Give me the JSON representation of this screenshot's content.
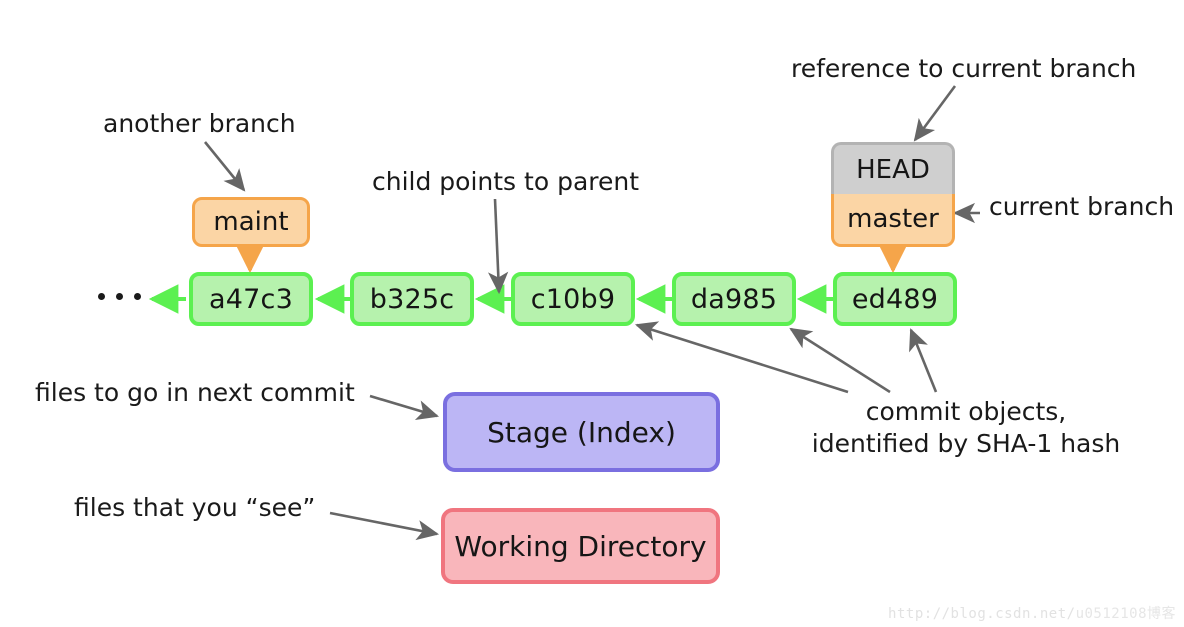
{
  "colors": {
    "commit_fill": "#b6f2ad",
    "commit_border": "#5cf051",
    "branch_fill": "#fbd5a5",
    "branch_border": "#f5a54a",
    "head_fill": "#cfcfcf",
    "head_border": "#b3b3b3",
    "stage_fill": "#bcb6f5",
    "stage_border": "#7a6fe0",
    "workdir_fill": "#f9b6bb",
    "workdir_border": "#f0757f",
    "annotation_arrow": "#666666",
    "text": "#1a1a1a"
  },
  "commits": [
    {
      "id": "a47c3",
      "label": "a47c3"
    },
    {
      "id": "b325c",
      "label": "b325c"
    },
    {
      "id": "c10b9",
      "label": "c10b9"
    },
    {
      "id": "da985",
      "label": "da985"
    },
    {
      "id": "ed489",
      "label": "ed489"
    }
  ],
  "refs": {
    "head": "HEAD",
    "master": "master",
    "maint": "maint"
  },
  "areas": {
    "stage": "Stage (Index)",
    "working_directory": "Working Directory"
  },
  "annotations": {
    "another_branch": "another branch",
    "child_points_to_parent": "child points to parent",
    "reference_to_current_branch": "reference to current branch",
    "current_branch": "current branch",
    "commit_objects_line1": "commit objects,",
    "commit_objects_line2": "identified by SHA-1 hash",
    "files_next_commit": "files to go in next commit",
    "files_you_see": "files that you “see”"
  },
  "ellipsis": {
    "dot_count": 3,
    "meaning": "earlier commits continue"
  },
  "watermark": {
    "url": "http://blog.csdn.net/",
    "overlap": "u0512108博客"
  }
}
